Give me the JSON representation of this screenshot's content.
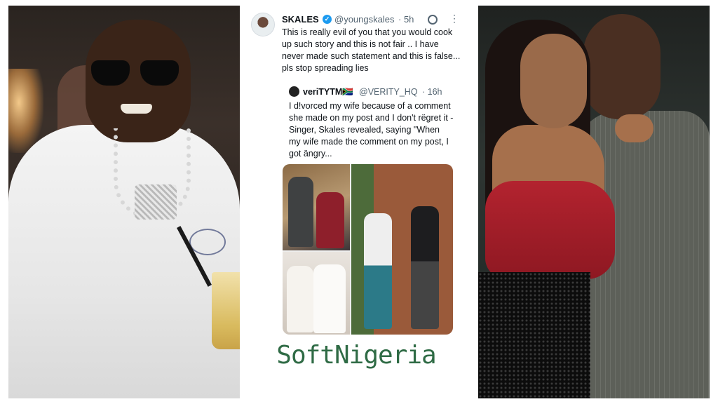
{
  "tweet": {
    "author_name": "SKALES",
    "author_handle": "@youngskales",
    "time": "· 5h",
    "more": "⋮",
    "verified": "✓",
    "text": "This is really evil of you that you would cook up such story and this is not fair .. I have never made such statement and this is false... pls stop spreading lies"
  },
  "quote": {
    "name": "veriTYTM🇿🇦",
    "handle": "@VERITY_HQ",
    "time": "· 16h",
    "text": "I d!vorced my wife because of a comment she made on my post and I don't rëgret it - Singer, Skales revealed, saying \"When my wife made the comment on my post, I got ängry..."
  },
  "watermark": "SoftNigeria",
  "icons": {
    "verified": "verified-badge-icon",
    "grok": "grok-icon",
    "more": "more-options-icon"
  },
  "colors": {
    "verified_blue": "#1d9bf0",
    "watermark_green": "#2f6b45",
    "handle_gray": "#536471"
  }
}
